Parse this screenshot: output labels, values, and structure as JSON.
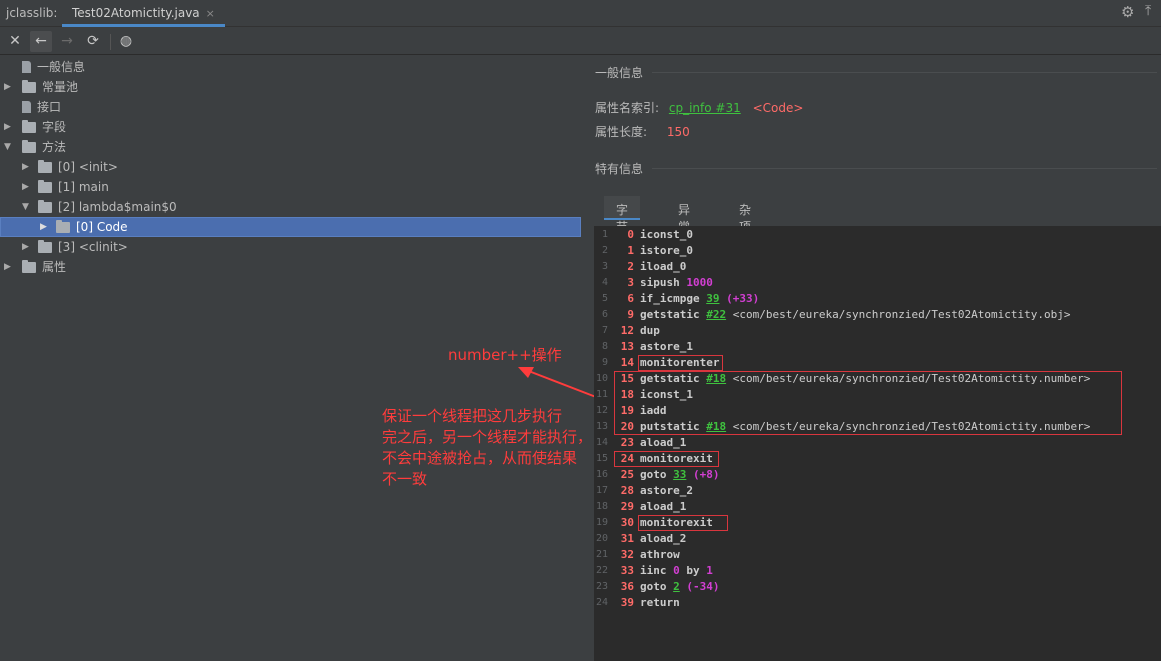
{
  "tabbar": {
    "tool_title": "jclasslib:",
    "tab_label": "Test02Atomictity.java",
    "tab_close": "×",
    "gear_icon": "⚙",
    "collapse_icon": "⤒"
  },
  "toolbar": {
    "close_icon": "✕",
    "back_icon": "←",
    "forward_icon": "→",
    "refresh_icon": "⟳",
    "web_icon": "◍"
  },
  "tree": {
    "general": "一般信息",
    "constant_pool": "常量池",
    "interfaces": "接口",
    "fields": "字段",
    "methods": "方法",
    "method_0": "[0] <init>",
    "method_1": "[1] main",
    "method_2": "[2] lambda$main$0",
    "code": "[0] Code",
    "method_3": "[3] <clinit>",
    "attributes": "属性"
  },
  "general_info": {
    "title": "一般信息",
    "attr_name_index_label": "属性名索引:",
    "attr_name_index_link": "cp_info #31",
    "attr_name_index_value": "<Code>",
    "attr_length_label": "属性长度:",
    "attr_length_value": "150"
  },
  "specific_info": {
    "title": "特有信息",
    "tabs": [
      "字节码",
      "异常表",
      "杂项"
    ]
  },
  "bytecode": [
    {
      "ln": "1",
      "off": "0",
      "op": "iconst_0"
    },
    {
      "ln": "2",
      "off": "1",
      "op": "istore_0"
    },
    {
      "ln": "3",
      "off": "2",
      "op": "iload_0"
    },
    {
      "ln": "4",
      "off": "3",
      "op": "sipush",
      "num": "1000"
    },
    {
      "ln": "5",
      "off": "6",
      "op": "if_icmpge",
      "link": "39",
      "rel": "(+33)"
    },
    {
      "ln": "6",
      "off": "9",
      "op": "getstatic",
      "link": "#22",
      "ref": "<com/best/eureka/synchronzied/Test02Atomictity.obj>"
    },
    {
      "ln": "7",
      "off": "12",
      "op": "dup"
    },
    {
      "ln": "8",
      "off": "13",
      "op": "astore_1"
    },
    {
      "ln": "9",
      "off": "14",
      "op": "monitorenter"
    },
    {
      "ln": "10",
      "off": "15",
      "op": "getstatic",
      "link": "#18",
      "ref": "<com/best/eureka/synchronzied/Test02Atomictity.number>"
    },
    {
      "ln": "11",
      "off": "18",
      "op": "iconst_1"
    },
    {
      "ln": "12",
      "off": "19",
      "op": "iadd"
    },
    {
      "ln": "13",
      "off": "20",
      "op": "putstatic",
      "link": "#18",
      "ref": "<com/best/eureka/synchronzied/Test02Atomictity.number>"
    },
    {
      "ln": "14",
      "off": "23",
      "op": "aload_1"
    },
    {
      "ln": "15",
      "off": "24",
      "op": "monitorexit"
    },
    {
      "ln": "16",
      "off": "25",
      "op": "goto",
      "link": "33",
      "rel": "(+8)"
    },
    {
      "ln": "17",
      "off": "28",
      "op": "astore_2"
    },
    {
      "ln": "18",
      "off": "29",
      "op": "aload_1"
    },
    {
      "ln": "19",
      "off": "30",
      "op": "monitorexit"
    },
    {
      "ln": "20",
      "off": "31",
      "op": "aload_2"
    },
    {
      "ln": "21",
      "off": "32",
      "op": "athrow"
    },
    {
      "ln": "22",
      "off": "33",
      "op": "iinc",
      "num": "0",
      "mid": "by",
      "num2": "1"
    },
    {
      "ln": "23",
      "off": "36",
      "op": "goto",
      "link": "2",
      "rel": "(-34)"
    },
    {
      "ln": "24",
      "off": "39",
      "op": "return"
    }
  ],
  "annotations": {
    "label1": "number++操作",
    "label2_lines": [
      "保证一个线程把这几步执行",
      "完之后，另一个线程才能执行，",
      "不会中途被抢占，从而使结果",
      "不一致"
    ]
  },
  "colors": {
    "accent": "#4a88c7",
    "selection": "#4b6eaf",
    "offset_red": "#ff6b68",
    "link_green": "#3fc13f",
    "number_magenta": "#d23fd2",
    "annotation_red": "#ff3c3c"
  }
}
